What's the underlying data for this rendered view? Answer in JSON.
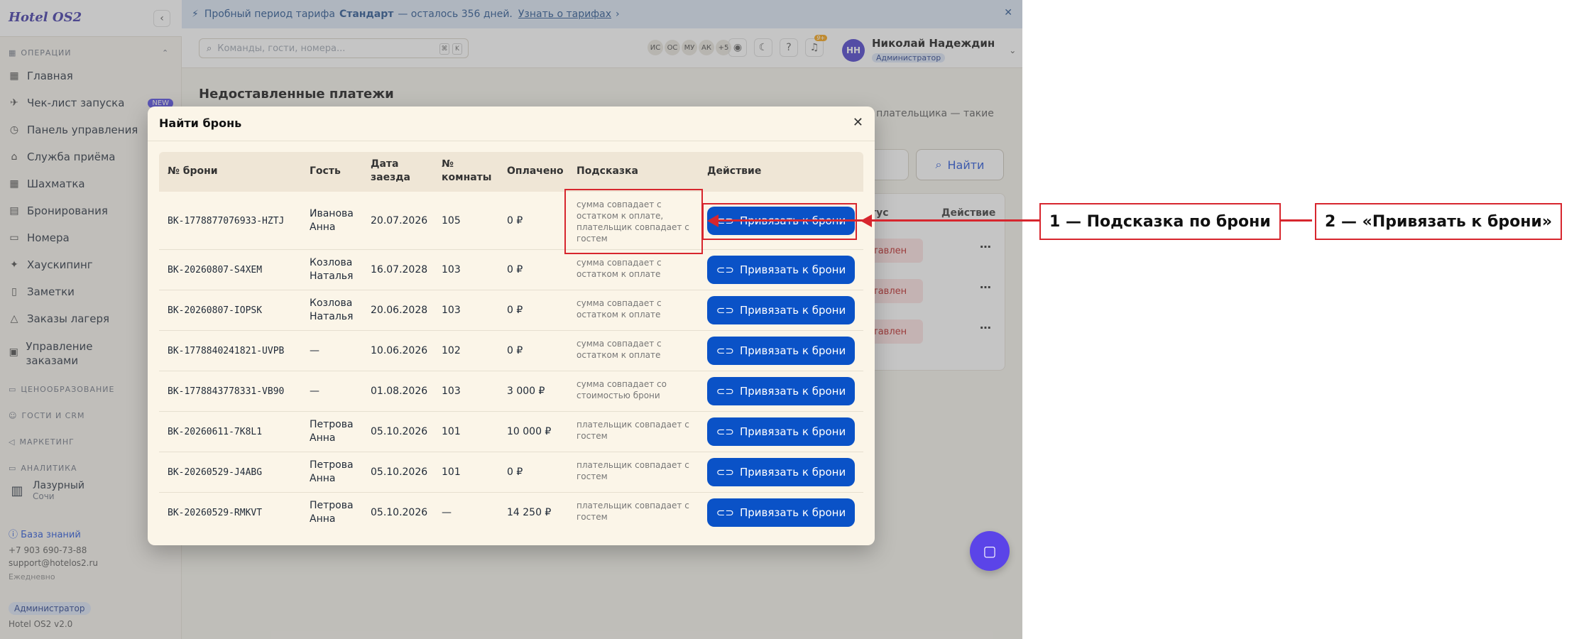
{
  "banner": {
    "pre": "Пробный период тарифа",
    "plan": "Стандарт",
    "post": "— осталось 356 дней.",
    "link": "Узнать о тарифах",
    "link_arrow": "›",
    "close": "✕"
  },
  "sidebar": {
    "logo": "Hotel OS2",
    "collapse": "‹",
    "section_ops": "ОПЕРАЦИИ",
    "items": [
      {
        "label": "Главная",
        "icon": "▦"
      },
      {
        "label": "Чек-лист запуска",
        "icon": "✈",
        "badge": "NEW"
      },
      {
        "label": "Панель управления",
        "icon": "◷"
      },
      {
        "label": "Служба приёма",
        "icon": "⌂"
      },
      {
        "label": "Шахматка",
        "icon": "▦"
      },
      {
        "label": "Бронирования",
        "icon": "▤"
      },
      {
        "label": "Номера",
        "icon": "▭"
      },
      {
        "label": "Хаускипинг",
        "icon": "✦"
      },
      {
        "label": "Заметки",
        "icon": "▯"
      },
      {
        "label": "Заказы лагеря",
        "icon": "△"
      },
      {
        "label": "Управление заказами",
        "icon": "▣"
      }
    ],
    "sections": [
      "ЦЕНООБРАЗОВАНИЕ",
      "ГОСТИ И CRM",
      "МАРКЕТИНГ",
      "АНАЛИТИКА"
    ],
    "hotel_name": "Лазурный",
    "hotel_city": "Сочи",
    "kb": "База знаний",
    "phone": "+7 903 690-73-88",
    "email": "support@hotelos2.ru",
    "hours": "Ежедневно",
    "role": "Администратор",
    "version": "Hotel OS2 v2.0"
  },
  "topbar": {
    "search_placeholder": "Команды, гости, номера...",
    "kbd1": "⌘",
    "kbd2": "K",
    "avatars": [
      "ИС",
      "ОС",
      "МУ",
      "АК",
      "+5"
    ],
    "notif_count": "9+",
    "user_initials": "НН",
    "user_name": "Николай Надеждин",
    "user_role": "Администратор"
  },
  "page": {
    "title": "Недоставленные платежи",
    "subtitle": "ые плательщика — такие",
    "find": "Найти",
    "th_status": "тус",
    "th_action": "Действие",
    "status": "ставлен",
    "dots": "⋯"
  },
  "modal": {
    "title": "Найти бронь",
    "close": "✕",
    "columns": [
      "№ брони",
      "Гость",
      "Дата заезда",
      "№ комнаты",
      "Оплачено",
      "Подсказка",
      "Действие"
    ],
    "button_label": "Привязать к брони",
    "rows": [
      {
        "id": "BK-1778877076933-HZTJ",
        "guest": "Иванова Анна",
        "date": "20.07.2026",
        "room": "105",
        "paid": "0 ₽",
        "hint": "сумма совпадает с остатком к оплате, плательщик совпадает с гостем"
      },
      {
        "id": "BK-20260807-S4XEM",
        "guest": "Козлова Наталья",
        "date": "16.07.2028",
        "room": "103",
        "paid": "0 ₽",
        "hint": "сумма совпадает с остатком к оплате"
      },
      {
        "id": "BK-20260807-IOPSK",
        "guest": "Козлова Наталья",
        "date": "20.06.2028",
        "room": "103",
        "paid": "0 ₽",
        "hint": "сумма совпадает с остатком к оплате"
      },
      {
        "id": "BK-1778840241821-UVPB",
        "guest": "—",
        "date": "10.06.2026",
        "room": "102",
        "paid": "0 ₽",
        "hint": "сумма совпадает с остатком к оплате"
      },
      {
        "id": "BK-1778843778331-VB90",
        "guest": "—",
        "date": "01.08.2026",
        "room": "103",
        "paid": "3 000 ₽",
        "hint": "сумма совпадает со стоимостью брони"
      },
      {
        "id": "BK-20260611-7K8L1",
        "guest": "Петрова Анна",
        "date": "05.10.2026",
        "room": "101",
        "paid": "10 000 ₽",
        "hint": "плательщик совпадает с гостем"
      },
      {
        "id": "BK-20260529-J4ABG",
        "guest": "Петрова Анна",
        "date": "05.10.2026",
        "room": "101",
        "paid": "0 ₽",
        "hint": "плательщик совпадает с гостем"
      },
      {
        "id": "BK-20260529-RMKVT",
        "guest": "Петрова Анна",
        "date": "05.10.2026",
        "room": "—",
        "paid": "14 250 ₽",
        "hint": "плательщик совпадает с гостем"
      }
    ]
  },
  "annotations": {
    "label1": "1 — Подсказка по брони",
    "label2": "2 — «Привязать к брони»"
  },
  "colors": {
    "primary": "#0a52c7",
    "accent": "#4f46e5",
    "annotation": "#d7262e"
  }
}
